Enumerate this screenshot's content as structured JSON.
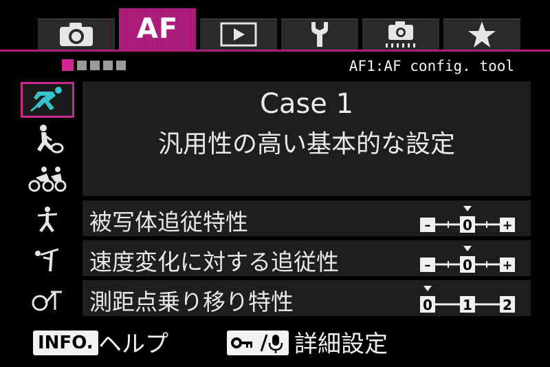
{
  "tabs": [
    {
      "name": "shooting",
      "icon": "camera-icon",
      "label": ""
    },
    {
      "name": "af",
      "icon": "",
      "label": "AF"
    },
    {
      "name": "playback",
      "icon": "playback-icon",
      "label": ""
    },
    {
      "name": "setup",
      "icon": "wrench-icon",
      "label": ""
    },
    {
      "name": "custom",
      "icon": "custom-functions-icon",
      "label": ""
    },
    {
      "name": "mymenu",
      "icon": "star-icon",
      "label": ""
    }
  ],
  "pager": {
    "pages": 5,
    "current": 1
  },
  "menu_path": "AF1:AF config. tool",
  "cases": [
    {
      "icon": "sprinter-icon",
      "selected": true
    },
    {
      "icon": "tennis-player-icon",
      "selected": false
    },
    {
      "icon": "cyclists-icon",
      "selected": false
    },
    {
      "icon": "skater-icon",
      "selected": false
    },
    {
      "icon": "gymnast-icon",
      "selected": false
    },
    {
      "icon": "flexible-case-icon",
      "selected": false
    }
  ],
  "description": {
    "title": "Case 1",
    "subtitle": "汎用性の高い基本的な設定"
  },
  "params": [
    {
      "label": "被写体追従特性",
      "scale": [
        "–",
        "0",
        "+"
      ],
      "value": 0
    },
    {
      "label": "速度変化に対する追従性",
      "scale": [
        "–",
        "0",
        "+"
      ],
      "value": 0
    },
    {
      "label": "測距点乗り移り特性",
      "scale": [
        "0",
        "1",
        "2"
      ],
      "value": 0
    }
  ],
  "footer": {
    "info_label": "INFO.",
    "help_label": "ヘルプ",
    "detail_label": "詳細設定"
  },
  "colors": {
    "accent": "#b01e7e",
    "panel": "#1e1e1e",
    "icon_cyan": "#36c3c9"
  }
}
